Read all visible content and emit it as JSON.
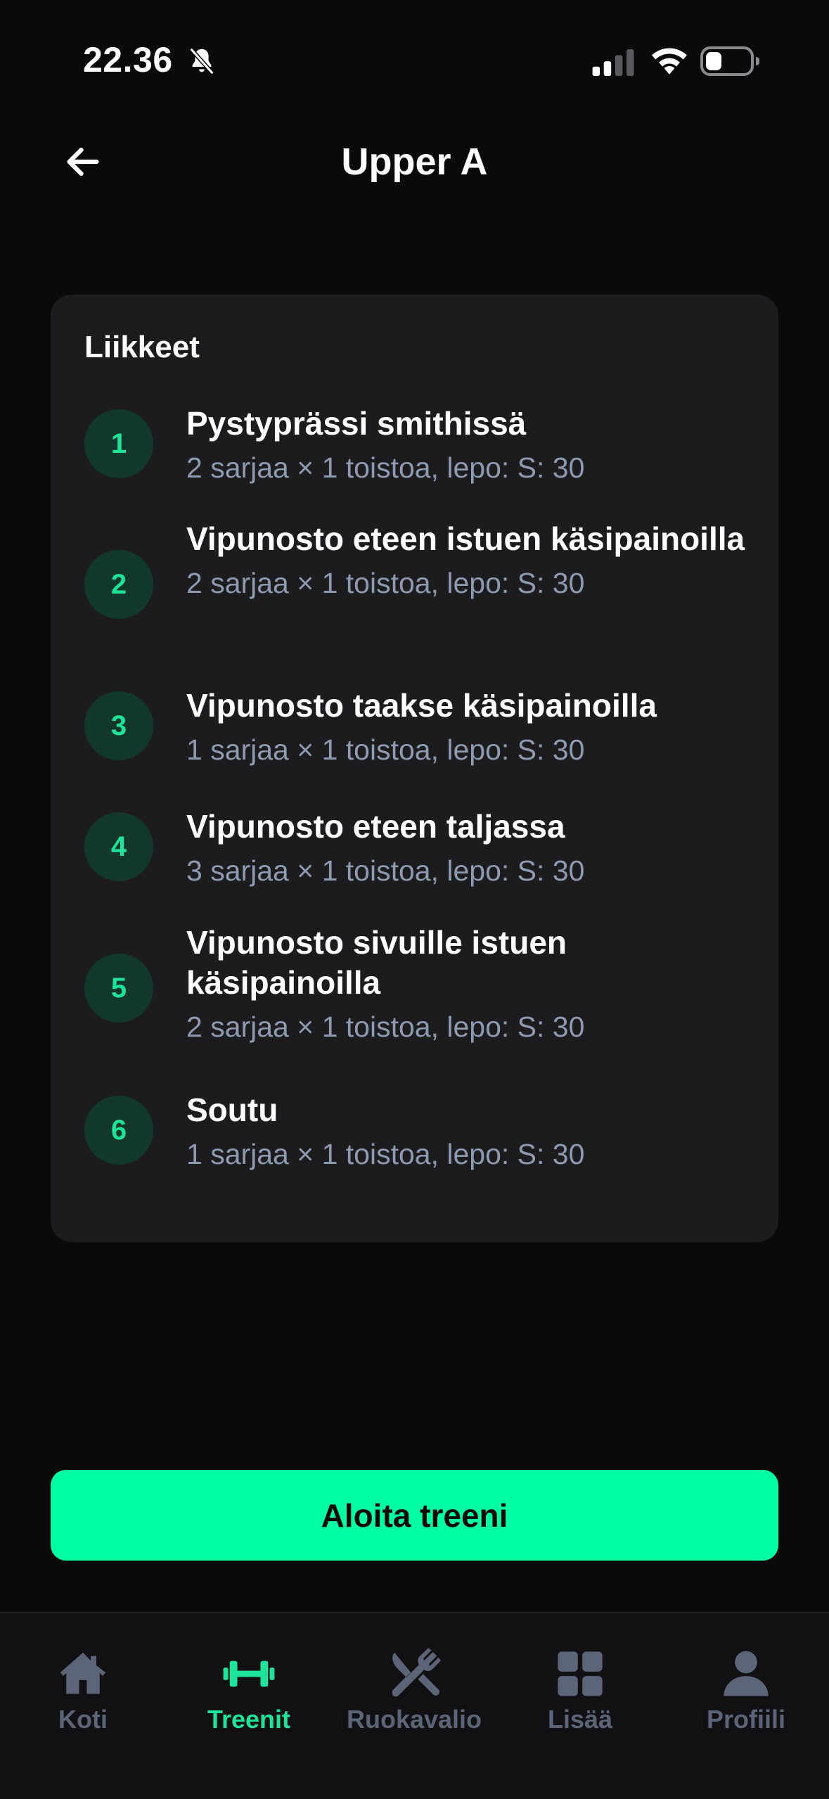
{
  "status_bar": {
    "time": "22.36"
  },
  "header": {
    "title": "Upper A"
  },
  "card": {
    "title": "Liikkeet",
    "exercises": [
      {
        "number": "1",
        "name": "Pystyprässi smithissä",
        "detail": "2 sarjaa × 1 toistoa, lepo: S: 30"
      },
      {
        "number": "2",
        "name": "Vipunosto eteen istuen käsipainoilla",
        "detail": "2 sarjaa × 1 toistoa, lepo: S: 30"
      },
      {
        "number": "3",
        "name": "Vipunosto taakse käsipainoilla",
        "detail": "1 sarjaa × 1 toistoa, lepo: S: 30"
      },
      {
        "number": "4",
        "name": "Vipunosto eteen taljassa",
        "detail": "3 sarjaa × 1 toistoa, lepo: S: 30"
      },
      {
        "number": "5",
        "name": "Vipunosto sivuille istuen käsipainoilla",
        "detail": "2 sarjaa × 1 toistoa, lepo: S: 30"
      },
      {
        "number": "6",
        "name": "Soutu",
        "detail": "1 sarjaa × 1 toistoa, lepo: S: 30"
      }
    ]
  },
  "start_button": {
    "label": "Aloita treeni"
  },
  "bottom_nav": {
    "items": [
      {
        "label": "Koti",
        "icon": "home-icon",
        "active": false
      },
      {
        "label": "Treenit",
        "icon": "dumbbell-icon",
        "active": true
      },
      {
        "label": "Ruokavalio",
        "icon": "fork-knife-icon",
        "active": false
      },
      {
        "label": "Lisää",
        "icon": "grid-icon",
        "active": false
      },
      {
        "label": "Profiili",
        "icon": "user-icon",
        "active": false
      }
    ]
  },
  "colors": {
    "background": "#0a0a0a",
    "card": "#1c1c1e",
    "accent": "#00ffa3",
    "accent_text": "#1ee39a",
    "muted": "#8e9ab0",
    "nav_inactive": "#5c6478"
  }
}
